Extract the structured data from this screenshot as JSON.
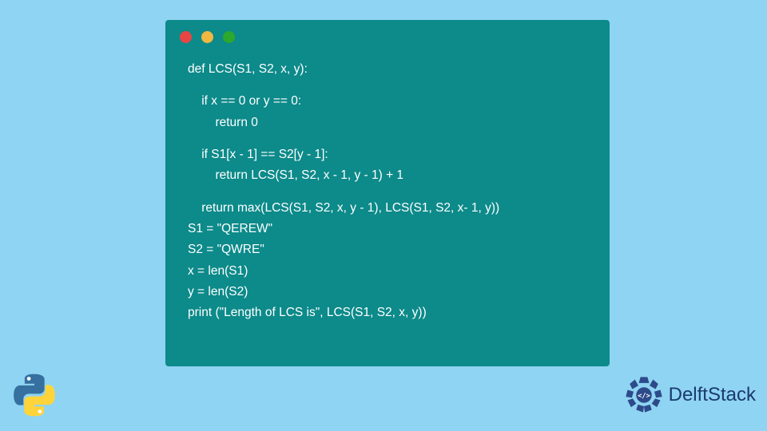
{
  "code": {
    "line1": "def LCS(S1, S2, x, y):",
    "line2": "    if x == 0 or y == 0:",
    "line3": "        return 0",
    "line4": "    if S1[x - 1] == S2[y - 1]:",
    "line5": "        return LCS(S1, S2, x - 1, y - 1) + 1",
    "line6": "    return max(LCS(S1, S2, x, y - 1), LCS(S1, S2, x- 1, y))",
    "line7": "S1 = \"QEREW\"",
    "line8": "S2 = \"QWRE\"",
    "line9": "x = len(S1)",
    "line10": "y = len(S2)",
    "line11": "print (\"Length of LCS is\", LCS(S1, S2, x, y))"
  },
  "branding": {
    "name": "DelftStack"
  }
}
